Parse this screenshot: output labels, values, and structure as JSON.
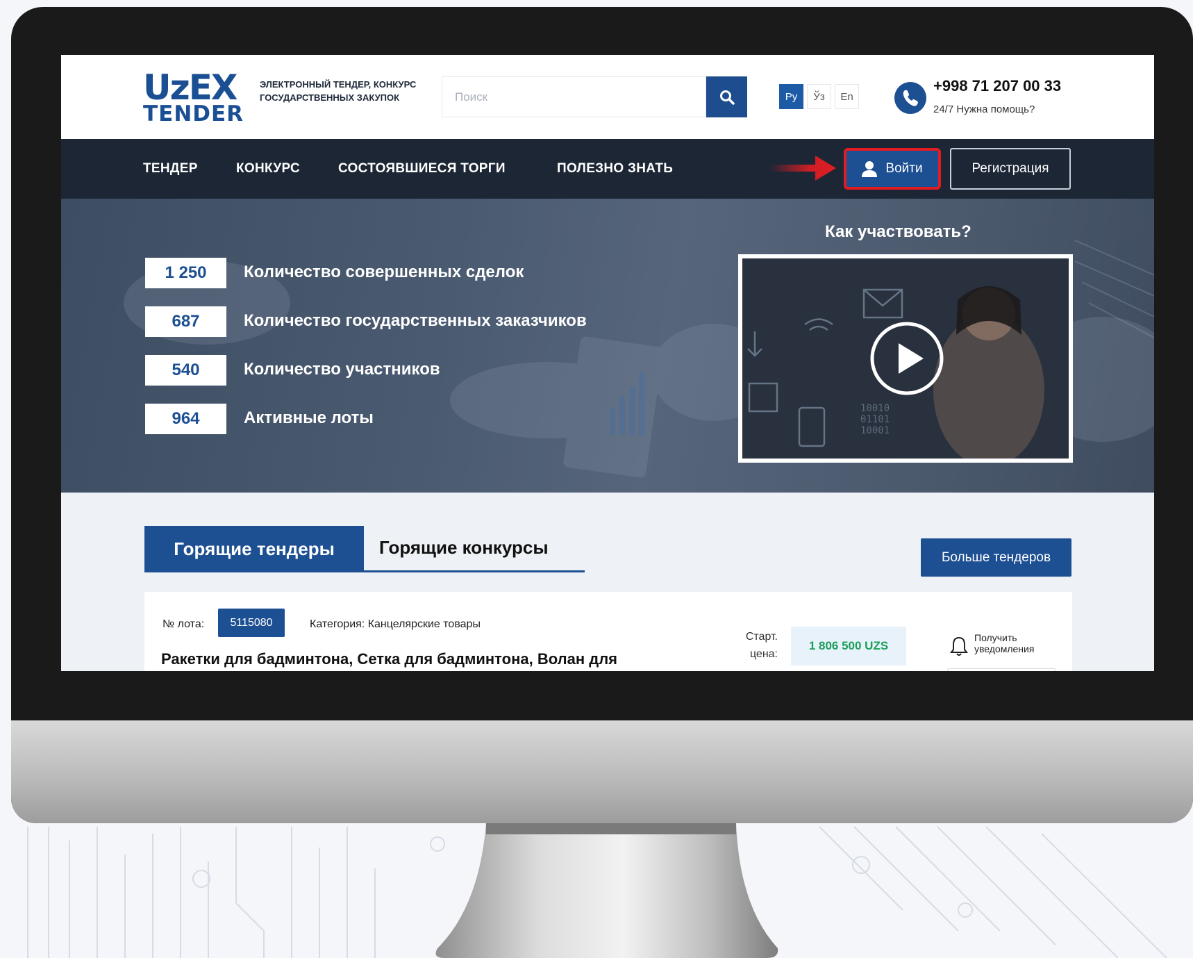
{
  "logo": {
    "top": "UzEX",
    "bottom": "TENDER"
  },
  "tagline": "ЭЛЕКТРОННЫЙ ТЕНДЕР, КОНКУРС ГОСУДАРСТВЕННЫХ ЗАКУПОК",
  "search": {
    "placeholder": "Поиск",
    "value": ""
  },
  "languages": [
    {
      "label": "Ру",
      "active": true
    },
    {
      "label": "Ўз",
      "active": false
    },
    {
      "label": "En",
      "active": false
    }
  ],
  "contact": {
    "phone": "+998 71 207 00 33",
    "help": "24/7 Нужна помощь?"
  },
  "nav": {
    "items": [
      "ТЕНДЕР",
      "КОНКУРС",
      "СОСТОЯВШИЕСЯ ТОРГИ",
      "ПОЛЕЗНО ЗНАТЬ"
    ],
    "login": "Войти",
    "register": "Регистрация"
  },
  "stats": [
    {
      "value": "1 250",
      "label": "Количество совершенных сделок"
    },
    {
      "value": "687",
      "label": "Количество государственных заказчиков"
    },
    {
      "value": "540",
      "label": "Количество участников"
    },
    {
      "value": "964",
      "label": "Активные лоты"
    }
  ],
  "video": {
    "title": "Как участвовать?"
  },
  "tabs": [
    {
      "label": "Горящие тендеры",
      "active": true
    },
    {
      "label": "Горящие конкурсы",
      "active": false
    }
  ],
  "more_button": "Больше тендеров",
  "lot": {
    "number_label": "№ лота:",
    "number": "5115080",
    "category": "Категория: Канцелярские товары",
    "title": "Ракетки для бадминтона, Сетка для бадминтона, Волан для",
    "price_label": "Старт. цена:",
    "price": "1 806 500 UZS",
    "notify": "Получить уведомления"
  },
  "colors": {
    "brand": "#1d4f93",
    "nav_bg": "#1c2635",
    "highlight": "#e11d22",
    "price": "#1c9f5a"
  },
  "icons": [
    "search-icon",
    "phone-icon",
    "user-icon",
    "play-icon",
    "bell-icon",
    "arrow-icon"
  ]
}
